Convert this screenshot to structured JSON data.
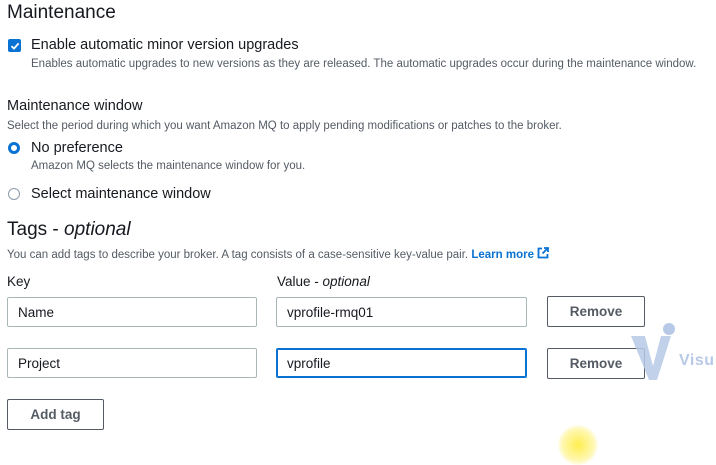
{
  "maintenance": {
    "heading": "Maintenance",
    "auto_upgrade": {
      "label": "Enable automatic minor version upgrades",
      "description": "Enables automatic upgrades to new versions as they are released. The automatic upgrades occur during the maintenance window.",
      "checked": true
    },
    "window": {
      "label": "Maintenance window",
      "description": "Select the period during which you want Amazon MQ to apply pending modifications or patches to the broker.",
      "options": [
        {
          "label": "No preference",
          "description": "Amazon MQ selects the maintenance window for you.",
          "selected": true
        },
        {
          "label": "Select maintenance window",
          "selected": false
        }
      ]
    }
  },
  "tags": {
    "heading": "Tags",
    "heading_suffix": "optional",
    "description": "You can add tags to describe your broker. A tag consists of a case-sensitive key-value pair.",
    "learn_more": "Learn more",
    "key_header": "Key",
    "value_header": "Value",
    "value_header_suffix": "optional",
    "rows": [
      {
        "key": "Name",
        "value": "vprofile-rmq01",
        "remove_label": "Remove"
      },
      {
        "key": "Project",
        "value": "vprofile",
        "remove_label": "Remove"
      }
    ],
    "add_tag_label": "Add tag"
  },
  "watermark": {
    "text": "Visu"
  },
  "colors": {
    "accent": "#0972d3",
    "text": "#16191f",
    "secondary": "#545b64"
  }
}
